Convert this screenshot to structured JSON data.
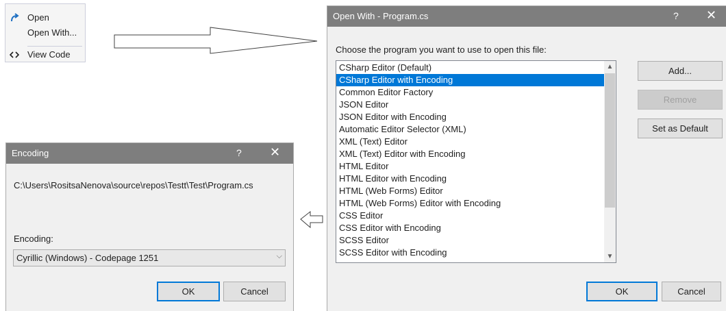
{
  "context_menu": {
    "items": [
      {
        "icon": "redo-arrow-icon",
        "label": "Open"
      },
      {
        "icon": "",
        "label": "Open With..."
      },
      {
        "icon": "code-brackets-icon",
        "label": "View Code"
      }
    ]
  },
  "open_with": {
    "title": "Open With - Program.cs",
    "help_glyph": "?",
    "close_glyph": "✕",
    "prompt": "Choose the program you want to use to open this file:",
    "programs": [
      "CSharp Editor (Default)",
      "CSharp Editor with Encoding",
      "Common Editor Factory",
      "JSON Editor",
      "JSON Editor with Encoding",
      "Automatic Editor Selector (XML)",
      "XML (Text) Editor",
      "XML (Text) Editor with Encoding",
      "HTML Editor",
      "HTML Editor with Encoding",
      "HTML (Web Forms) Editor",
      "HTML (Web Forms) Editor with Encoding",
      "CSS Editor",
      "CSS Editor with Encoding",
      "SCSS Editor",
      "SCSS Editor with Encoding"
    ],
    "selected_program": "CSharp Editor with Encoding",
    "add_label": "Add...",
    "remove_label": "Remove",
    "set_default_label": "Set as Default",
    "ok_label": "OK",
    "cancel_label": "Cancel"
  },
  "encoding": {
    "title": "Encoding",
    "help_glyph": "?",
    "close_glyph": "✕",
    "file_path": "C:\\Users\\RositsaNenova\\source\\repos\\Testt\\Test\\Program.cs",
    "encoding_label": "Encoding:",
    "encoding_value": "Cyrillic (Windows) - Codepage 1251",
    "ok_label": "OK",
    "cancel_label": "Cancel"
  },
  "colors": {
    "titlebar": "#7e7e7e",
    "selection": "#0078d7",
    "dialog_bg": "#f0f0f0"
  }
}
